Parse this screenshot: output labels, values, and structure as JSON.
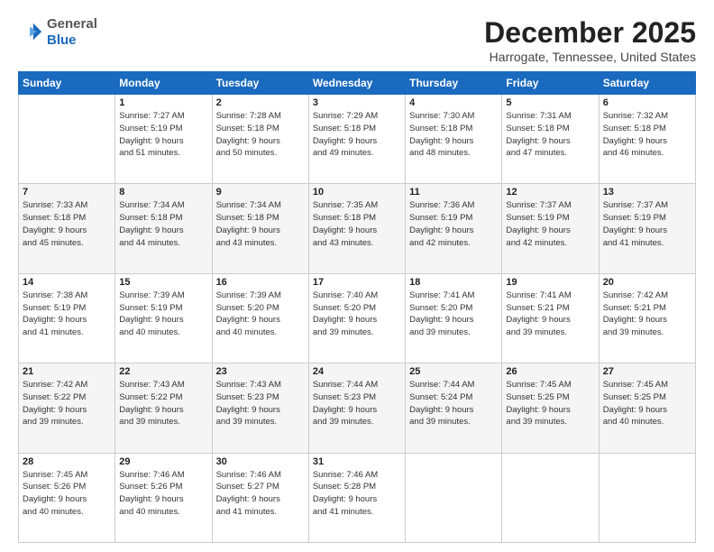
{
  "logo": {
    "general": "General",
    "blue": "Blue"
  },
  "title": {
    "month_year": "December 2025",
    "location": "Harrogate, Tennessee, United States"
  },
  "days_header": [
    "Sunday",
    "Monday",
    "Tuesday",
    "Wednesday",
    "Thursday",
    "Friday",
    "Saturday"
  ],
  "weeks": [
    [
      {
        "day": "",
        "info": ""
      },
      {
        "day": "1",
        "info": "Sunrise: 7:27 AM\nSunset: 5:19 PM\nDaylight: 9 hours\nand 51 minutes."
      },
      {
        "day": "2",
        "info": "Sunrise: 7:28 AM\nSunset: 5:18 PM\nDaylight: 9 hours\nand 50 minutes."
      },
      {
        "day": "3",
        "info": "Sunrise: 7:29 AM\nSunset: 5:18 PM\nDaylight: 9 hours\nand 49 minutes."
      },
      {
        "day": "4",
        "info": "Sunrise: 7:30 AM\nSunset: 5:18 PM\nDaylight: 9 hours\nand 48 minutes."
      },
      {
        "day": "5",
        "info": "Sunrise: 7:31 AM\nSunset: 5:18 PM\nDaylight: 9 hours\nand 47 minutes."
      },
      {
        "day": "6",
        "info": "Sunrise: 7:32 AM\nSunset: 5:18 PM\nDaylight: 9 hours\nand 46 minutes."
      }
    ],
    [
      {
        "day": "7",
        "info": "Sunrise: 7:33 AM\nSunset: 5:18 PM\nDaylight: 9 hours\nand 45 minutes."
      },
      {
        "day": "8",
        "info": "Sunrise: 7:34 AM\nSunset: 5:18 PM\nDaylight: 9 hours\nand 44 minutes."
      },
      {
        "day": "9",
        "info": "Sunrise: 7:34 AM\nSunset: 5:18 PM\nDaylight: 9 hours\nand 43 minutes."
      },
      {
        "day": "10",
        "info": "Sunrise: 7:35 AM\nSunset: 5:18 PM\nDaylight: 9 hours\nand 43 minutes."
      },
      {
        "day": "11",
        "info": "Sunrise: 7:36 AM\nSunset: 5:19 PM\nDaylight: 9 hours\nand 42 minutes."
      },
      {
        "day": "12",
        "info": "Sunrise: 7:37 AM\nSunset: 5:19 PM\nDaylight: 9 hours\nand 42 minutes."
      },
      {
        "day": "13",
        "info": "Sunrise: 7:37 AM\nSunset: 5:19 PM\nDaylight: 9 hours\nand 41 minutes."
      }
    ],
    [
      {
        "day": "14",
        "info": "Sunrise: 7:38 AM\nSunset: 5:19 PM\nDaylight: 9 hours\nand 41 minutes."
      },
      {
        "day": "15",
        "info": "Sunrise: 7:39 AM\nSunset: 5:19 PM\nDaylight: 9 hours\nand 40 minutes."
      },
      {
        "day": "16",
        "info": "Sunrise: 7:39 AM\nSunset: 5:20 PM\nDaylight: 9 hours\nand 40 minutes."
      },
      {
        "day": "17",
        "info": "Sunrise: 7:40 AM\nSunset: 5:20 PM\nDaylight: 9 hours\nand 39 minutes."
      },
      {
        "day": "18",
        "info": "Sunrise: 7:41 AM\nSunset: 5:20 PM\nDaylight: 9 hours\nand 39 minutes."
      },
      {
        "day": "19",
        "info": "Sunrise: 7:41 AM\nSunset: 5:21 PM\nDaylight: 9 hours\nand 39 minutes."
      },
      {
        "day": "20",
        "info": "Sunrise: 7:42 AM\nSunset: 5:21 PM\nDaylight: 9 hours\nand 39 minutes."
      }
    ],
    [
      {
        "day": "21",
        "info": "Sunrise: 7:42 AM\nSunset: 5:22 PM\nDaylight: 9 hours\nand 39 minutes."
      },
      {
        "day": "22",
        "info": "Sunrise: 7:43 AM\nSunset: 5:22 PM\nDaylight: 9 hours\nand 39 minutes."
      },
      {
        "day": "23",
        "info": "Sunrise: 7:43 AM\nSunset: 5:23 PM\nDaylight: 9 hours\nand 39 minutes."
      },
      {
        "day": "24",
        "info": "Sunrise: 7:44 AM\nSunset: 5:23 PM\nDaylight: 9 hours\nand 39 minutes."
      },
      {
        "day": "25",
        "info": "Sunrise: 7:44 AM\nSunset: 5:24 PM\nDaylight: 9 hours\nand 39 minutes."
      },
      {
        "day": "26",
        "info": "Sunrise: 7:45 AM\nSunset: 5:25 PM\nDaylight: 9 hours\nand 39 minutes."
      },
      {
        "day": "27",
        "info": "Sunrise: 7:45 AM\nSunset: 5:25 PM\nDaylight: 9 hours\nand 40 minutes."
      }
    ],
    [
      {
        "day": "28",
        "info": "Sunrise: 7:45 AM\nSunset: 5:26 PM\nDaylight: 9 hours\nand 40 minutes."
      },
      {
        "day": "29",
        "info": "Sunrise: 7:46 AM\nSunset: 5:26 PM\nDaylight: 9 hours\nand 40 minutes."
      },
      {
        "day": "30",
        "info": "Sunrise: 7:46 AM\nSunset: 5:27 PM\nDaylight: 9 hours\nand 41 minutes."
      },
      {
        "day": "31",
        "info": "Sunrise: 7:46 AM\nSunset: 5:28 PM\nDaylight: 9 hours\nand 41 minutes."
      },
      {
        "day": "",
        "info": ""
      },
      {
        "day": "",
        "info": ""
      },
      {
        "day": "",
        "info": ""
      }
    ]
  ]
}
